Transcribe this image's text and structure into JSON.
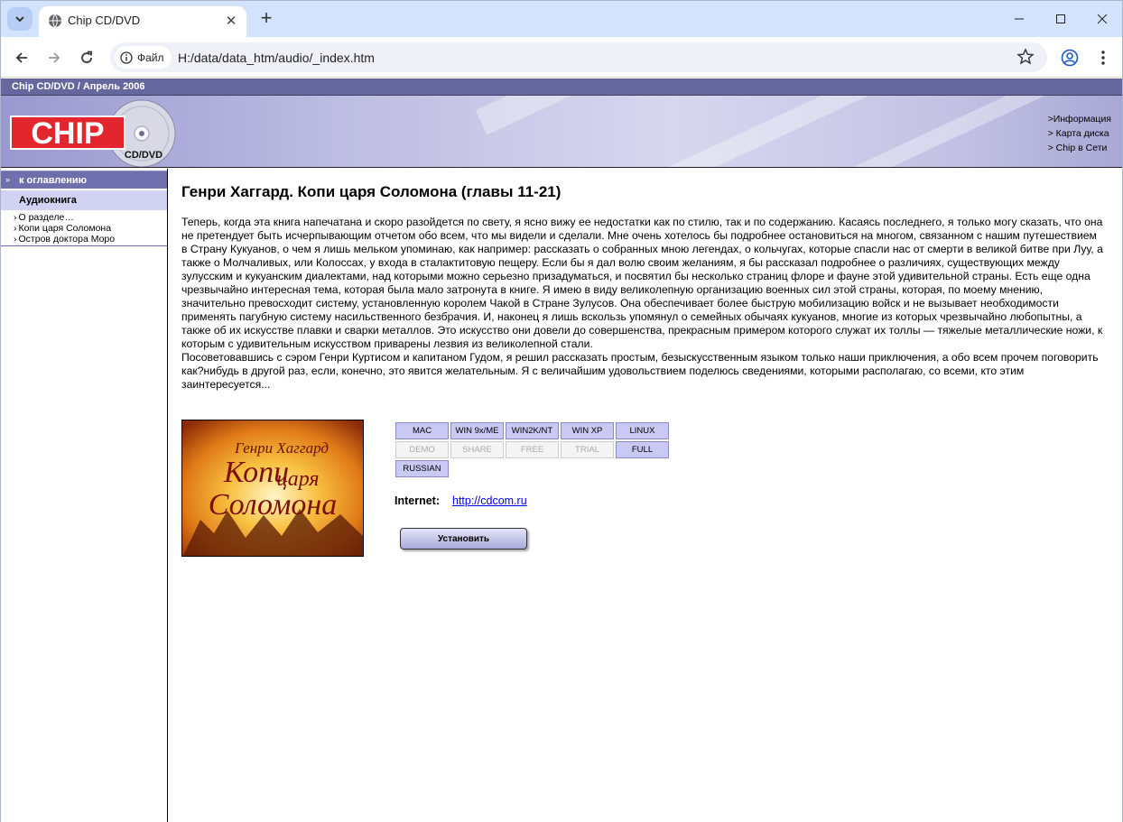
{
  "browser": {
    "tab_title": "Chip CD/DVD",
    "file_chip": "Файл",
    "url": "H:/data/data_htm/audio/_index.htm"
  },
  "header": {
    "topbar_text": "Chip CD/DVD / Апрель 2006",
    "logo_text": "CHIP",
    "logo_sub": "CD/DVD",
    "links": [
      ">Информация",
      "> Карта диска",
      "> Chip в Сети"
    ]
  },
  "sidebar": {
    "back_label": "к оглавлению",
    "section_label": "Аудиокнига",
    "items": [
      "О разделе…",
      "Копи царя Соломона",
      "Остров доктора Моро"
    ]
  },
  "main": {
    "title": "Генри Хаггард. Копи царя Соломона (главы 11-21)",
    "paragraph1": "Теперь, когда эта книга напечатана и скоро разойдется по свету, я ясно вижу ее недостатки как по стилю, так и по содержанию. Касаясь последнего, я только могу сказать, что она не претендует быть исчерпывающим отчетом обо всем, что мы видели и сделали. Мне очень хотелось бы подробнее остановиться на многом, связанном с нашим путешествием в Страну Кукуанов, о чем я лишь мельком упоминаю, как например: рассказать о собранных мною легендах, о кольчугах, которые спасли нас от смерти в великой битве при Луу, а также о Молчаливых, или Колоссах, у входа в сталактитовую пещеру. Если бы я дал волю своим желаниям, я бы рассказал подробнее о различиях, существующих между зулусским и кукуанским диалектами, над которыми можно серьезно призадуматься, и посвятил бы несколько страниц флоре и фауне этой удивительной страны. Есть еще одна чрезвычайно интересная тема, которая была мало затронута в книге. Я имею в виду великолепную организацию военных сил этой страны, которая, по моему мнению, значительно превосходит систему, установленную королем Чакой в Стране Зулусов. Она обеспечивает более быструю мобилизацию войск и не вызывает необходимости применять пагубную систему насильственного безбрачия. И, наконец я лишь вскользь упомянул о семейных обычаях кукуанов, многие из которых чрезвычайно любопытны, а также об их искусстве плавки и сварки металлов. Это искусство они довели до совершенства, прекрасным примером которого служат их толлы — тяжелые металлические ножи, к которым с удивительным искусством приварены лезвия из великолепной стали.",
    "paragraph2": "Посоветовавшись с сэром Генри Куртисом и капитаном Гудом, я решил рассказать простым, безыскусственным языком только наши приключения, а обо всем прочем поговорить как?нибудь в другой раз, если, конечно, это явится желательным. Я с величайшим удовольствием поделюсь сведениями, которыми располагаю, со всеми, кто этим заинтересуется...",
    "cover": {
      "author": "Генри Хаггард",
      "title_line1": "Копи",
      "title_line2": "царя",
      "title_line3": "Соломона"
    },
    "badges": [
      {
        "label": "MAC",
        "active": true
      },
      {
        "label": "WIN 9x/ME",
        "active": true
      },
      {
        "label": "WIN2K/NT",
        "active": true
      },
      {
        "label": "WIN XP",
        "active": true
      },
      {
        "label": "LINUX",
        "active": true
      },
      {
        "label": "DEMO",
        "active": false
      },
      {
        "label": "SHARE",
        "active": false
      },
      {
        "label": "FREE",
        "active": false
      },
      {
        "label": "TRIAL",
        "active": false
      },
      {
        "label": "FULL",
        "active": true
      },
      {
        "label": "RUSSIAN",
        "active": true
      }
    ],
    "internet_label": "Internet:",
    "internet_url": "http://cdcom.ru",
    "install_label": "Установить"
  },
  "colors": {
    "topbar": "#67679f",
    "section": "#d2d2f2",
    "badge_active": "#c9c9f3",
    "logo_red": "#e3262d"
  }
}
